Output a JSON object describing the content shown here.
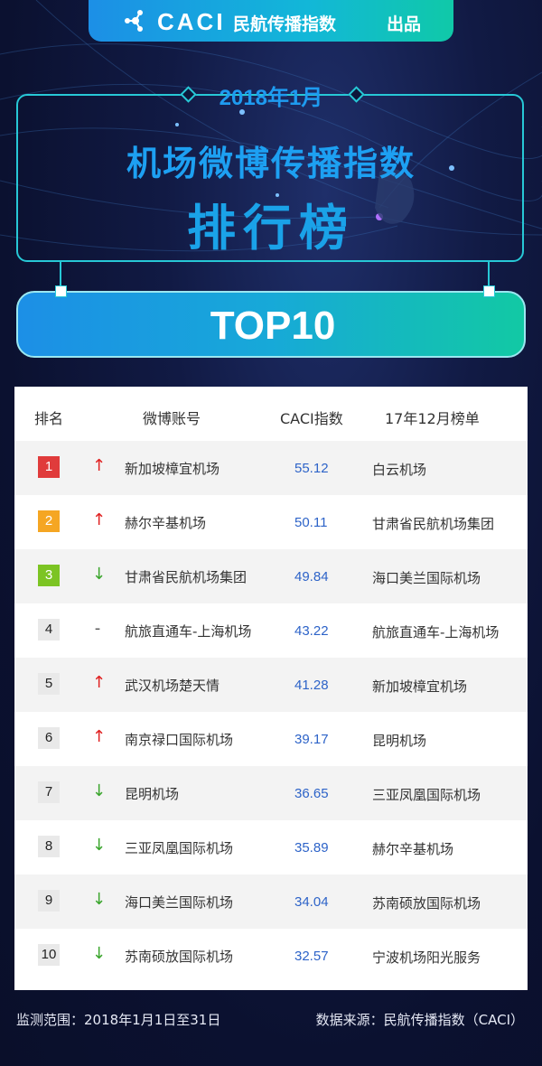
{
  "header": {
    "brand_logo_text": "CACI",
    "brand_name": "民航传播指数",
    "produced_label": "出品"
  },
  "hero": {
    "date": "2018年1月",
    "title": "机场微博传播指数",
    "subtitle": "排行榜",
    "banner": "TOP10"
  },
  "table": {
    "headers": [
      "排名",
      "微博账号",
      "CACI指数",
      "17年12月榜单"
    ],
    "rows": [
      {
        "rank": "1",
        "trend": "up",
        "account": "新加坡樟宜机场",
        "index": "55.12",
        "prev": "白云机场"
      },
      {
        "rank": "2",
        "trend": "up",
        "account": "赫尔辛基机场",
        "index": "50.11",
        "prev": "甘肃省民航机场集团"
      },
      {
        "rank": "3",
        "trend": "down",
        "account": "甘肃省民航机场集团",
        "index": "49.84",
        "prev": "海口美兰国际机场"
      },
      {
        "rank": "4",
        "trend": "flat",
        "account": "航旅直通车-上海机场",
        "index": "43.22",
        "prev": "航旅直通车-上海机场"
      },
      {
        "rank": "5",
        "trend": "up",
        "account": "武汉机场楚天情",
        "index": "41.28",
        "prev": "新加坡樟宜机场"
      },
      {
        "rank": "6",
        "trend": "up",
        "account": "南京禄口国际机场",
        "index": "39.17",
        "prev": "昆明机场"
      },
      {
        "rank": "7",
        "trend": "down",
        "account": "昆明机场",
        "index": "36.65",
        "prev": "三亚凤凰国际机场"
      },
      {
        "rank": "8",
        "trend": "down",
        "account": "三亚凤凰国际机场",
        "index": "35.89",
        "prev": "赫尔辛基机场"
      },
      {
        "rank": "9",
        "trend": "down",
        "account": "海口美兰国际机场",
        "index": "34.04",
        "prev": "苏南硕放国际机场"
      },
      {
        "rank": "10",
        "trend": "down",
        "account": "苏南硕放国际机场",
        "index": "32.57",
        "prev": "宁波机场阳光服务"
      }
    ]
  },
  "colors": {
    "rank1": "#e03b3b",
    "rank2": "#f5a623",
    "rank3": "#7cc423",
    "up": "#e02020",
    "down": "#3aa52c",
    "flat": "#555555"
  },
  "footer": {
    "range": "监测范围：2018年1月1日至31日",
    "source": "数据来源：民航传播指数（CACI）"
  }
}
